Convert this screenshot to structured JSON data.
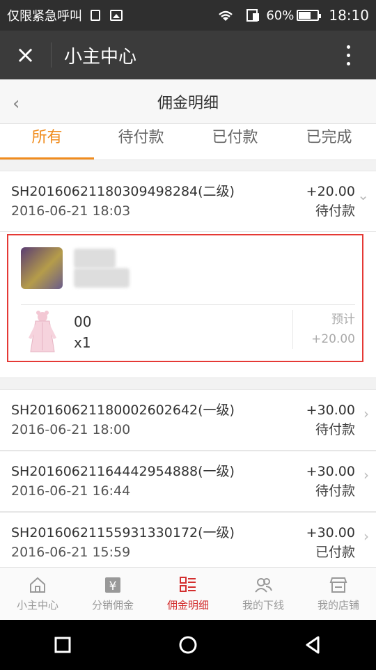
{
  "status_bar": {
    "carrier": "仅限紧急呼叫",
    "battery_percent": "60%",
    "battery_level": 0.6,
    "time": "18:10"
  },
  "app_bar": {
    "close_icon": "×",
    "title": "小主中心"
  },
  "header": {
    "back": "‹",
    "title": "佣金明细"
  },
  "tabs": [
    {
      "label": "所有",
      "active": true
    },
    {
      "label": "待付款",
      "active": false
    },
    {
      "label": "已付款",
      "active": false
    },
    {
      "label": "已完成",
      "active": false
    }
  ],
  "orders": [
    {
      "order_no": "SH20160621180309498284(二级)",
      "date": "2016-06-21 18:03",
      "amount": "+20.00",
      "status": "待付款",
      "expanded": true,
      "detail": {
        "buyer_name": "　　　",
        "buyer_sub": "微　　　",
        "product_name": "00",
        "product_qty": "x1",
        "expect_label": "预计",
        "expect_amount": "+20.00"
      }
    },
    {
      "order_no": "SH20160621180002602642(一级)",
      "date": "2016-06-21 18:00",
      "amount": "+30.00",
      "status": "待付款"
    },
    {
      "order_no": "SH20160621164442954888(一级)",
      "date": "2016-06-21 16:44",
      "amount": "+30.00",
      "status": "待付款"
    },
    {
      "order_no": "SH20160621155931330172(一级)",
      "date": "2016-06-21 15:59",
      "amount": "+30.00",
      "status": "已付款"
    }
  ],
  "bottom_nav": [
    {
      "label": "小主中心",
      "icon": "home-icon"
    },
    {
      "label": "分销佣金",
      "icon": "yen-icon"
    },
    {
      "label": "佣金明细",
      "icon": "list-icon",
      "active": true
    },
    {
      "label": "我的下线",
      "icon": "people-icon"
    },
    {
      "label": "我的店铺",
      "icon": "store-icon"
    }
  ],
  "colors": {
    "accent_orange": "#f08c1e",
    "active_red": "#d32f2f",
    "highlight_border": "#e53935"
  }
}
